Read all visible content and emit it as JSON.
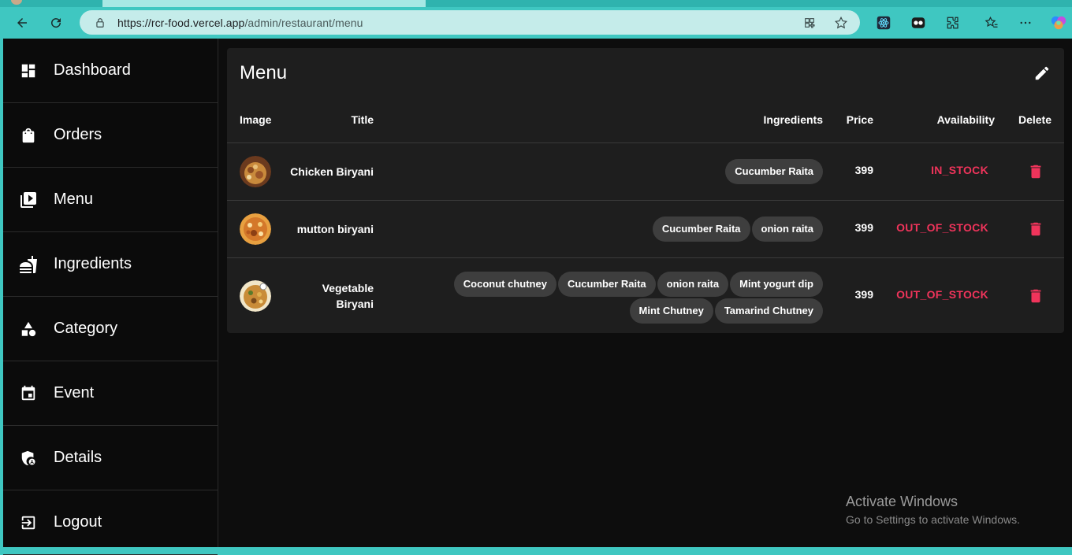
{
  "browser": {
    "url_host": "https://rcr-food.vercel.app",
    "url_path": "/admin/restaurant/menu",
    "accent": "#3fc7c1"
  },
  "sidebar": {
    "items": [
      {
        "label": "Dashboard",
        "icon": "dashboard-icon"
      },
      {
        "label": "Orders",
        "icon": "shopping-bag-icon"
      },
      {
        "label": "Menu",
        "icon": "video-library-icon"
      },
      {
        "label": "Ingredients",
        "icon": "fastfood-icon"
      },
      {
        "label": "Category",
        "icon": "category-shapes-icon"
      },
      {
        "label": "Event",
        "icon": "calendar-event-icon"
      },
      {
        "label": "Details",
        "icon": "admin-panel-icon"
      },
      {
        "label": "Logout",
        "icon": "logout-icon"
      }
    ]
  },
  "menu": {
    "title": "Menu",
    "columns": {
      "image": "Image",
      "title": "Title",
      "ingredients": "Ingredients",
      "price": "Price",
      "availability": "Availability",
      "delete": "Delete"
    },
    "rows": [
      {
        "title": "Chicken Biryani",
        "ingredients": [
          "Cucumber Raita"
        ],
        "price": "399",
        "availability": "IN_STOCK"
      },
      {
        "title": "mutton biryani",
        "ingredients": [
          "Cucumber Raita",
          "onion raita"
        ],
        "price": "399",
        "availability": "OUT_OF_STOCK"
      },
      {
        "title": "Vegetable Biryani",
        "ingredients": [
          "Coconut chutney",
          "Cucumber Raita",
          "onion raita",
          "Mint yogurt dip",
          "Mint Chutney",
          "Tamarind Chutney"
        ],
        "price": "399",
        "availability": "OUT_OF_STOCK"
      }
    ],
    "availability_color": "#f0345b"
  },
  "watermark": {
    "line1": "Activate Windows",
    "line2": "Go to Settings to activate Windows."
  }
}
